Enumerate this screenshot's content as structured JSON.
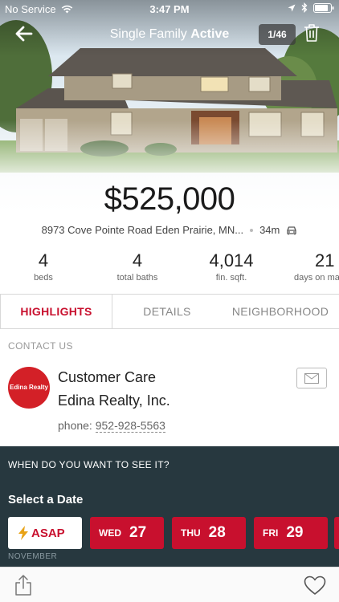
{
  "status_bar": {
    "carrier": "No Service",
    "time": "3:47 PM"
  },
  "nav": {
    "title_prefix": "Single Family",
    "title_status": "Active",
    "photo_counter": "1/46"
  },
  "listing": {
    "price": "$525,000",
    "address": "8973 Cove Pointe Road Eden Prairie, MN...",
    "drive_time": "34m"
  },
  "stats": [
    {
      "value": "4",
      "label": "beds"
    },
    {
      "value": "4",
      "label": "total baths"
    },
    {
      "value": "4,014",
      "label": "fin. sqft."
    },
    {
      "value": "21",
      "label": "days on ma"
    }
  ],
  "tabs": [
    {
      "label": "HIGHLIGHTS",
      "active": true
    },
    {
      "label": "DETAILS",
      "active": false
    },
    {
      "label": "NEIGHBORHOOD",
      "active": false
    }
  ],
  "contact": {
    "header": "CONTACT US",
    "logo_text": "Edina Realty",
    "name": "Customer Care",
    "company": "Edina Realty, Inc.",
    "phone_label": "phone:",
    "phone": "952-928-5563"
  },
  "schedule": {
    "question": "WHEN DO YOU WANT TO SEE IT?",
    "select_label": "Select a Date",
    "asap_label": "ASAP",
    "month": "NOVEMBER",
    "dates": [
      {
        "dow": "WED",
        "day": "27"
      },
      {
        "dow": "THU",
        "day": "28"
      },
      {
        "dow": "FRI",
        "day": "29"
      }
    ]
  },
  "colors": {
    "accent": "#c8102e",
    "schedule_bg": "#27383f"
  }
}
